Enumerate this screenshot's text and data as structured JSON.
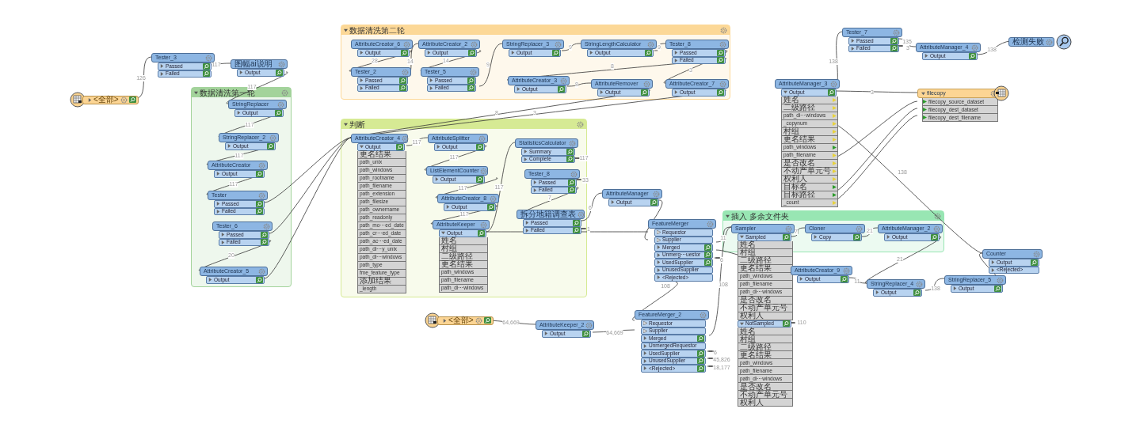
{
  "bookmarks": [
    {
      "title": "数据清洗第一轮",
      "color": "#a3d39b"
    },
    {
      "title": "数据清洗第二轮",
      "color": "#fcd897"
    },
    {
      "title": "判断",
      "color": "#d6ea94"
    },
    {
      "title": "插入 多余文件夹",
      "color": "#98e6b3"
    }
  ],
  "nodes": [
    {
      "kind": "reader",
      "ports": [
        {
          "label": "<全部>",
          "kind": "output",
          "expanded": false,
          "inspect": true
        }
      ]
    },
    {
      "kind": "transformer",
      "name": "Tester_3",
      "ports": [
        {
          "label": "Passed",
          "kind": "output",
          "expanded": false,
          "inspect": true
        },
        {
          "label": "Failed",
          "kind": "output",
          "expanded": false,
          "inspect": true
        }
      ]
    },
    {
      "kind": "transformer",
      "name": "图幅ai说明",
      "ports": [
        {
          "label": "Output",
          "kind": "output",
          "expanded": false,
          "inspect": true
        }
      ]
    },
    {
      "kind": "transformer",
      "name": "StringReplacer",
      "ports": [
        {
          "label": "Output",
          "kind": "output",
          "expanded": false,
          "inspect": true
        }
      ]
    },
    {
      "kind": "transformer",
      "name": "StringReplacer_2",
      "ports": [
        {
          "label": "Output",
          "kind": "output",
          "expanded": false,
          "inspect": true
        }
      ]
    },
    {
      "kind": "transformer",
      "name": "AttributeCreator",
      "ports": [
        {
          "label": "Output",
          "kind": "output",
          "expanded": false,
          "inspect": true
        }
      ]
    },
    {
      "kind": "transformer",
      "name": "Tester",
      "ports": [
        {
          "label": "Passed",
          "kind": "output",
          "expanded": false,
          "inspect": true
        },
        {
          "label": "Failed",
          "kind": "output",
          "expanded": false,
          "inspect": true
        }
      ]
    },
    {
      "kind": "transformer",
      "name": "Tester_6",
      "ports": [
        {
          "label": "Passed",
          "kind": "output",
          "expanded": false,
          "inspect": true
        },
        {
          "label": "Failed",
          "kind": "output",
          "expanded": false,
          "inspect": true
        }
      ]
    },
    {
      "kind": "transformer",
      "name": "AttributeCreator_5",
      "ports": [
        {
          "label": "Output",
          "kind": "output",
          "expanded": false,
          "inspect": true
        }
      ]
    },
    {
      "kind": "transformer",
      "name": "AttributeCreator_6",
      "ports": [
        {
          "label": "Output",
          "kind": "output",
          "expanded": false,
          "inspect": true
        }
      ]
    },
    {
      "kind": "transformer",
      "name": "AttributeCreator_2",
      "ports": [
        {
          "label": "Output",
          "kind": "output",
          "expanded": false,
          "inspect": true
        }
      ]
    },
    {
      "kind": "transformer",
      "name": "StringReplacer_3",
      "ports": [
        {
          "label": "Output",
          "kind": "output",
          "expanded": false,
          "inspect": true
        }
      ]
    },
    {
      "kind": "transformer",
      "name": "StringLengthCalculator",
      "ports": [
        {
          "label": "Output",
          "kind": "output",
          "expanded": false,
          "inspect": true
        }
      ]
    },
    {
      "kind": "transformer",
      "name": "Tester_8",
      "ports": [
        {
          "label": "Passed",
          "kind": "output",
          "expanded": false,
          "inspect": true
        },
        {
          "label": "Failed",
          "kind": "output",
          "expanded": false,
          "inspect": true
        }
      ]
    },
    {
      "kind": "transformer",
      "name": "Tester_2",
      "ports": [
        {
          "label": "Passed",
          "kind": "output",
          "expanded": false,
          "inspect": true
        },
        {
          "label": "Failed",
          "kind": "output",
          "expanded": false,
          "inspect": true
        }
      ]
    },
    {
      "kind": "transformer",
      "name": "Tester_5",
      "ports": [
        {
          "label": "Passed",
          "kind": "output",
          "expanded": false,
          "inspect": true
        },
        {
          "label": "Failed",
          "kind": "output",
          "expanded": false,
          "inspect": true
        }
      ]
    },
    {
      "kind": "transformer",
      "name": "AttributeCreator_3",
      "ports": [
        {
          "label": "Output",
          "kind": "output",
          "expanded": false,
          "inspect": true
        }
      ]
    },
    {
      "kind": "transformer",
      "name": "AttributeRemover",
      "ports": [
        {
          "label": "Output",
          "kind": "output",
          "expanded": false,
          "inspect": true
        }
      ]
    },
    {
      "kind": "transformer",
      "name": "AttributeCreator_7",
      "ports": [
        {
          "label": "Output",
          "kind": "output",
          "expanded": false,
          "inspect": true
        }
      ]
    },
    {
      "kind": "transformer",
      "name": "AttributeCreator_4",
      "ports": [
        {
          "label": "Output",
          "kind": "output",
          "expanded": true,
          "inspect": true,
          "attributes": [
            "更名结果",
            "path_unix",
            "path_windows",
            "path_rootname",
            "path_filename",
            "path_extension",
            "path_filesize",
            "path_ownername",
            "path_readonly",
            "path_mo⋯ed_date",
            "path_cr⋯ed_date",
            "path_ac⋯ed_date",
            "path_di⋯y_unix",
            "path_di⋯windows",
            "path_type",
            "fme_feature_type",
            "添加结果",
            "_length"
          ]
        }
      ]
    },
    {
      "kind": "transformer",
      "name": "AttributeSplitter",
      "ports": [
        {
          "label": "Output",
          "kind": "output",
          "expanded": false,
          "inspect": true
        }
      ]
    },
    {
      "kind": "transformer",
      "name": "ListElementCounter",
      "ports": [
        {
          "label": "Output",
          "kind": "output",
          "expanded": false,
          "inspect": true
        }
      ]
    },
    {
      "kind": "transformer",
      "name": "AttributeCreator_8",
      "ports": [
        {
          "label": "Output",
          "kind": "output",
          "expanded": false,
          "inspect": true
        }
      ]
    },
    {
      "kind": "transformer",
      "name": "AttributeKeeper",
      "ports": [
        {
          "label": "Output",
          "kind": "output",
          "expanded": true,
          "inspect": true,
          "attributes": [
            "姓名",
            "村组",
            "二级路径",
            "更名结果",
            "path_windows",
            "path_filename",
            "path_di⋯windows"
          ]
        }
      ]
    },
    {
      "kind": "transformer",
      "name": "StatisticsCalculator",
      "ports": [
        {
          "label": "Summary",
          "kind": "output",
          "expanded": false,
          "inspect": true
        },
        {
          "label": "Complete",
          "kind": "output",
          "expanded": false,
          "inspect": true
        }
      ]
    },
    {
      "kind": "transformer",
      "name": "Tester_8",
      "ports": [
        {
          "label": "Passed",
          "kind": "output",
          "expanded": false,
          "inspect": true
        },
        {
          "label": "Failed",
          "kind": "output",
          "expanded": false,
          "inspect": true
        }
      ]
    },
    {
      "kind": "transformer",
      "name": "拆分地籍调查表",
      "ports": [
        {
          "label": "Passed",
          "kind": "output",
          "expanded": false,
          "inspect": true
        },
        {
          "label": "Failed",
          "kind": "output",
          "expanded": false,
          "inspect": true
        }
      ]
    },
    {
      "kind": "transformer",
      "name": "AttributeManager",
      "ports": [
        {
          "label": "Output",
          "kind": "output",
          "expanded": false,
          "inspect": true
        }
      ]
    },
    {
      "kind": "transformer",
      "name": "FeatureMerger",
      "ports": [
        {
          "label": "Requestor",
          "kind": "input"
        },
        {
          "label": "Supplier",
          "kind": "input"
        },
        {
          "label": "Merged",
          "kind": "output",
          "expanded": false,
          "inspect": true
        },
        {
          "label": "Unmerg⋯uestor",
          "kind": "output",
          "expanded": false,
          "inspect": true
        },
        {
          "label": "UsedSupplier",
          "kind": "output",
          "expanded": false,
          "inspect": true
        },
        {
          "label": "UnusedSupplier",
          "kind": "output",
          "expanded": false,
          "inspect": false
        },
        {
          "label": "<Rejected>",
          "kind": "output",
          "expanded": false,
          "inspect": false
        }
      ]
    },
    {
      "kind": "transformer",
      "name": "FeatureMerger_2",
      "ports": [
        {
          "label": "Requestor",
          "kind": "input"
        },
        {
          "label": "Supplier",
          "kind": "input"
        },
        {
          "label": "Merged",
          "kind": "output",
          "expanded": false,
          "inspect": true
        },
        {
          "label": "UnmergedRequestor",
          "kind": "output",
          "expanded": false,
          "inspect": false
        },
        {
          "label": "UsedSupplier",
          "kind": "output",
          "expanded": false,
          "inspect": true
        },
        {
          "label": "UnusedSupplier",
          "kind": "output",
          "expanded": false,
          "inspect": true
        },
        {
          "label": "<Rejected>",
          "kind": "output",
          "expanded": false,
          "inspect": true
        }
      ]
    },
    {
      "kind": "reader",
      "ports": [
        {
          "label": "<全部>",
          "kind": "output",
          "expanded": false,
          "inspect": true
        }
      ]
    },
    {
      "kind": "transformer",
      "name": "AttributeKeeper_2",
      "ports": [
        {
          "label": "Output",
          "kind": "output",
          "expanded": false,
          "inspect": true
        }
      ]
    },
    {
      "kind": "transformer",
      "name": "Sampler",
      "ports": [
        {
          "label": "Sampled",
          "kind": "output",
          "expanded": true,
          "inspect": true,
          "attributes": [
            "姓名",
            "村组",
            "二级路径",
            "更名结果",
            "path_windows",
            "path_filename",
            "path_di⋯windows",
            "是否改名",
            "不动产单元号",
            "权利人"
          ]
        },
        {
          "label": "NotSampled",
          "kind": "output",
          "expanded": true,
          "inspect": true,
          "attributes": [
            "姓名",
            "村组",
            "二级路径",
            "更名结果",
            "path_windows",
            "path_filename",
            "path_di⋯windows",
            "是否改名",
            "不动产单元号",
            "权利人"
          ]
        }
      ]
    },
    {
      "kind": "transformer",
      "name": "Cloner",
      "ports": [
        {
          "label": "Copy",
          "kind": "output",
          "expanded": false,
          "inspect": true
        }
      ]
    },
    {
      "kind": "transformer",
      "name": "AttributeManager_2",
      "ports": [
        {
          "label": "Output",
          "kind": "output",
          "expanded": false,
          "inspect": true
        }
      ]
    },
    {
      "kind": "transformer",
      "name": "AttributeCreator_9",
      "ports": [
        {
          "label": "Output",
          "kind": "output",
          "expanded": false,
          "inspect": true
        }
      ]
    },
    {
      "kind": "transformer",
      "name": "StringReplacer_4",
      "ports": [
        {
          "label": "Output",
          "kind": "output",
          "expanded": false,
          "inspect": true
        }
      ]
    },
    {
      "kind": "transformer",
      "name": "StringReplacer_5",
      "ports": [
        {
          "label": "Output",
          "kind": "output",
          "expanded": false,
          "inspect": true
        }
      ]
    },
    {
      "kind": "transformer",
      "name": "Counter",
      "ports": [
        {
          "label": "Output",
          "kind": "output",
          "expanded": false,
          "inspect": true
        },
        {
          "label": "<Rejected>",
          "kind": "output",
          "expanded": false,
          "inspect": false
        }
      ]
    },
    {
      "kind": "transformer",
      "name": "Tester_7",
      "ports": [
        {
          "label": "Passed",
          "kind": "output",
          "expanded": false,
          "inspect": true
        },
        {
          "label": "Failed",
          "kind": "output",
          "expanded": false,
          "inspect": true
        }
      ]
    },
    {
      "kind": "transformer",
      "name": "AttributeManager_4",
      "ports": [
        {
          "label": "Output",
          "kind": "output",
          "expanded": false,
          "inspect": true
        }
      ]
    },
    {
      "kind": "inspector",
      "name": "检测失败"
    },
    {
      "kind": "transformer",
      "name": "AttributeManager_3",
      "ports": [
        {
          "label": "Output",
          "kind": "output",
          "expanded": true,
          "inspect": true,
          "attributes": [
            {
              "name": "姓名",
              "connected": false
            },
            {
              "name": "二级路径",
              "connected": false
            },
            {
              "name": "path_di⋯windows",
              "connected": false
            },
            {
              "name": "_copynum",
              "connected": false
            },
            {
              "name": "村组",
              "connected": false
            },
            {
              "name": "更名结果",
              "connected": false
            },
            {
              "name": "path_windows",
              "connected": true
            },
            {
              "name": "path_filename",
              "connected": false
            },
            {
              "name": "是否改名",
              "connected": false
            },
            {
              "name": "不动产单元号",
              "connected": false
            },
            {
              "name": "权利人",
              "connected": false
            },
            {
              "name": "目标名",
              "connected": true
            },
            {
              "name": "目标路径",
              "connected": true
            },
            {
              "name": "_count",
              "connected": false
            }
          ]
        }
      ]
    },
    {
      "kind": "writer",
      "name": "filecopy",
      "expanded": true,
      "attributes": [
        "filecopy_source_dataset",
        "filecopy_dest_dataset",
        "filecopy_dest_filename"
      ]
    }
  ],
  "link_counts": [
    "126",
    "117",
    "117",
    "117",
    "117",
    "117",
    "20",
    "28",
    "14",
    "14",
    "9",
    "9",
    "9",
    "8",
    "8",
    "3",
    "8",
    "3",
    "117",
    "117",
    "117",
    "117",
    "117",
    "117",
    "7",
    "33",
    "6",
    "1",
    "11",
    "6",
    "108",
    "108",
    "64,669",
    "64,669",
    "6",
    "45,826",
    "18,177",
    "7",
    "21",
    "21",
    "110",
    "11",
    "138",
    "138",
    "138",
    "3",
    "135",
    "3",
    "138"
  ]
}
